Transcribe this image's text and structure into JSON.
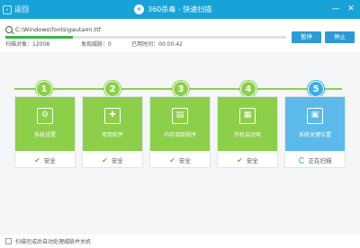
{
  "titlebar": {
    "back_label": "返回",
    "title": "360杀毒 - 快速扫描",
    "logo_text": "+",
    "minimize": "—",
    "close": "✕"
  },
  "scan": {
    "current_path": "C:\\Windows\\fonts\\gautami.ttf",
    "progress_percent": 24,
    "objects_label": "扫描对象：",
    "objects_value": "12008",
    "threats_label": "发现威胁：",
    "threats_value": "0",
    "elapsed_label": "已用时间：",
    "elapsed_value": "00:00:42"
  },
  "buttons": {
    "pause": "暂停",
    "stop": "停止"
  },
  "steps": [
    {
      "number": "1",
      "label": "系统设置",
      "status": "安全",
      "state": "done",
      "icon": "⚙"
    },
    {
      "number": "2",
      "label": "常用软件",
      "status": "安全",
      "state": "done",
      "icon": "✚"
    },
    {
      "number": "3",
      "label": "内存活跃程序",
      "status": "安全",
      "state": "done",
      "icon": "▤"
    },
    {
      "number": "4",
      "label": "开机启动项",
      "status": "安全",
      "state": "done",
      "icon": "▦"
    },
    {
      "number": "5",
      "label": "系统关键位置",
      "status": "正在扫描",
      "state": "active",
      "icon": "▣"
    }
  ],
  "footer": {
    "checkbox_label": "扫描完成后自动处理威胁并关机"
  },
  "colors": {
    "titlebar": "#18a3d8",
    "done": "#8ccf49",
    "active": "#5cbaea",
    "button": "#2b9ad6"
  }
}
